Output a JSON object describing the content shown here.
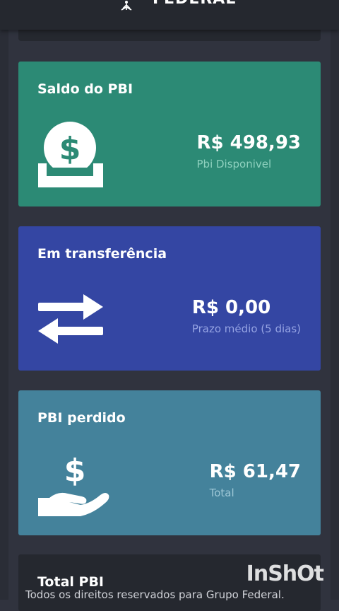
{
  "header": {
    "brand": "FEDERAL",
    "menu_icon": "hamburger-menu-icon",
    "logo_icon": "federal-logo-icon"
  },
  "cards": {
    "saldo": {
      "title": "Saldo do PBI",
      "value": "R$ 498,93",
      "caption": "Pbi Disponivel",
      "icon": "money-deposit-icon",
      "color": "#2c8a75"
    },
    "transfer": {
      "title": "Em transferência",
      "value": "R$ 0,00",
      "caption": "Prazo médio (5 dias)",
      "icon": "transfer-arrows-icon",
      "color": "#3446a3"
    },
    "perdido": {
      "title": "PBI perdido",
      "value": "R$ 61,47",
      "caption": "Total",
      "icon": "hand-money-icon",
      "color": "#44829b"
    },
    "total": {
      "title": "Total PBI"
    }
  },
  "footer": {
    "text": "Todos os direitos reservados para Grupo Federal."
  },
  "watermark": "InShOt"
}
